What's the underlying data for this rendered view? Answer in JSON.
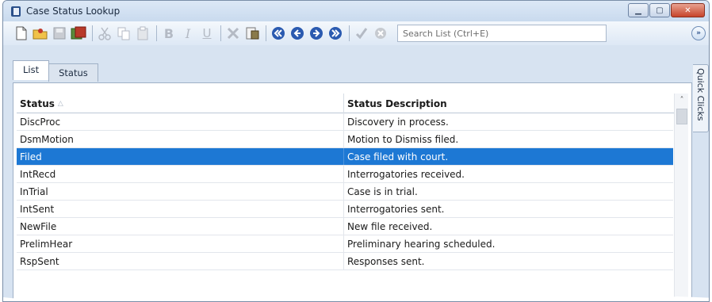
{
  "window": {
    "title": "Case Status Lookup"
  },
  "toolbar": {
    "icons": [
      "new-icon",
      "open-folder-icon",
      "save-icon",
      "save-close-icon",
      "cut-icon",
      "copy-icon",
      "paste-icon",
      "bold-icon",
      "italic-icon",
      "underline-icon",
      "delete-icon",
      "print-icon",
      "first-icon",
      "previous-icon",
      "next-icon",
      "last-icon",
      "check-icon",
      "cancel-icon"
    ],
    "search_placeholder": "Search List (Ctrl+E)"
  },
  "tabs": [
    {
      "label": "List"
    },
    {
      "label": "Status"
    }
  ],
  "table": {
    "columns": [
      "Status",
      "Status Description"
    ],
    "rows": [
      {
        "status": "DiscProc",
        "description": "Discovery in process."
      },
      {
        "status": "DsmMotion",
        "description": "Motion to Dismiss filed."
      },
      {
        "status": "Filed",
        "description": "Case filed with court.",
        "selected": true
      },
      {
        "status": "IntRecd",
        "description": "Interrogatories received."
      },
      {
        "status": "InTrial",
        "description": "Case is in trial."
      },
      {
        "status": "IntSent",
        "description": "Interrogatories sent."
      },
      {
        "status": "NewFile",
        "description": "New file received."
      },
      {
        "status": "PrelimHear",
        "description": "Preliminary hearing scheduled."
      },
      {
        "status": "RspSent",
        "description": "Responses sent."
      }
    ]
  },
  "side_tab": {
    "label": "Quick Clicks"
  },
  "colors": {
    "selection": "#1d78d4",
    "close_button": "#c7442a"
  }
}
